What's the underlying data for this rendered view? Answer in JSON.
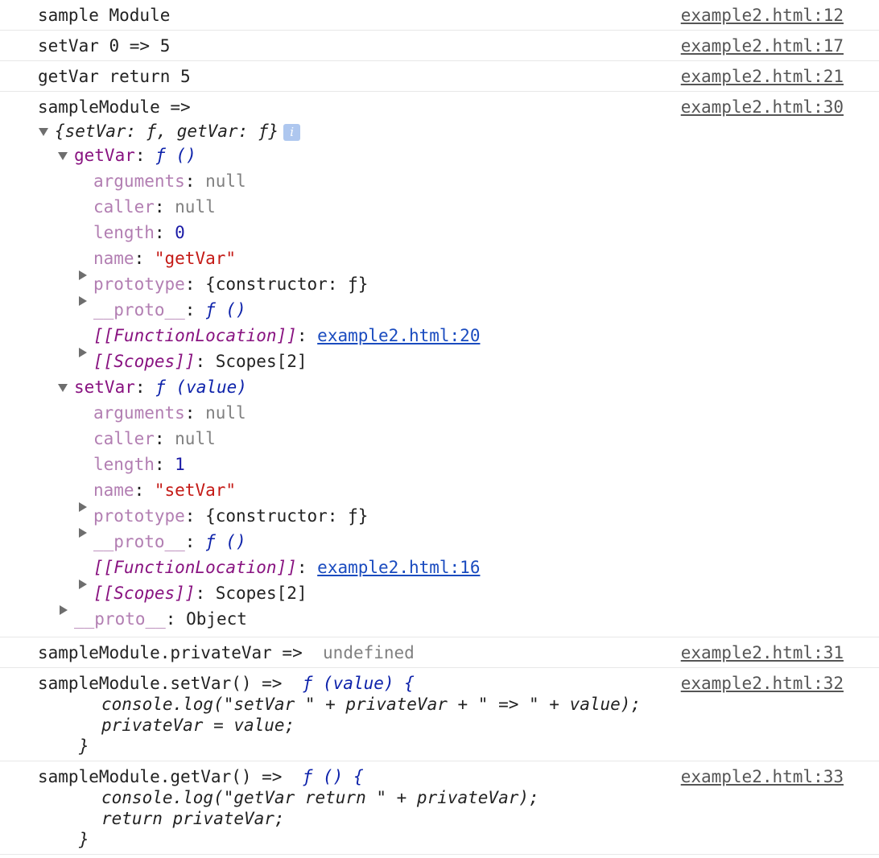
{
  "messages": [
    {
      "text": "sample Module",
      "source": "example2.html:12"
    },
    {
      "text": "setVar 0 => 5",
      "source": "example2.html:17"
    },
    {
      "text": "getVar return 5",
      "source": "example2.html:21"
    }
  ],
  "object_msg": {
    "label": "sampleModule =>",
    "source": "example2.html:30",
    "summary": "{setVar: ƒ, getVar: ƒ}",
    "info_glyph": "i",
    "getVar": {
      "key": "getVar",
      "sig": "ƒ ()",
      "arguments_key": "arguments",
      "arguments_val": "null",
      "caller_key": "caller",
      "caller_val": "null",
      "length_key": "length",
      "length_val": "0",
      "name_key": "name",
      "name_val": "\"getVar\"",
      "prototype_key": "prototype",
      "prototype_val": "{constructor: ƒ}",
      "proto_key": "__proto__",
      "proto_val": "ƒ ()",
      "location_key": "[[FunctionLocation]]",
      "location_val": "example2.html:20",
      "scopes_key": "[[Scopes]]",
      "scopes_val": "Scopes[2]"
    },
    "setVar": {
      "key": "setVar",
      "sig": "ƒ (value)",
      "arguments_key": "arguments",
      "arguments_val": "null",
      "caller_key": "caller",
      "caller_val": "null",
      "length_key": "length",
      "length_val": "1",
      "name_key": "name",
      "name_val": "\"setVar\"",
      "prototype_key": "prototype",
      "prototype_val": "{constructor: ƒ}",
      "proto_key": "__proto__",
      "proto_val": "ƒ ()",
      "location_key": "[[FunctionLocation]]",
      "location_val": "example2.html:16",
      "scopes_key": "[[Scopes]]",
      "scopes_val": "Scopes[2]"
    },
    "root_proto_key": "__proto__",
    "root_proto_val": "Object"
  },
  "privatevar_msg": {
    "label": "sampleModule.privateVar =>",
    "value": "undefined",
    "source": "example2.html:31"
  },
  "setvar_code_msg": {
    "label": "sampleModule.setVar() =>",
    "source": "example2.html:32",
    "lines": [
      "ƒ (value) {",
      "console.log(\"setVar \" + privateVar + \" => \" + value);",
      "privateVar = value;",
      "}"
    ]
  },
  "getvar_code_msg": {
    "label": "sampleModule.getVar() =>",
    "source": "example2.html:33",
    "lines": [
      "ƒ () {",
      "console.log(\"getVar return \" + privateVar);",
      "return privateVar;",
      "}"
    ]
  },
  "colors": {
    "key": "#881280",
    "dim_key": "#b27eb2",
    "null": "#808080",
    "number": "#1a1aa6",
    "string": "#c41a16",
    "function": "#0d22aa",
    "link": "#1a4bbf",
    "separator": "#e8e8e8"
  }
}
